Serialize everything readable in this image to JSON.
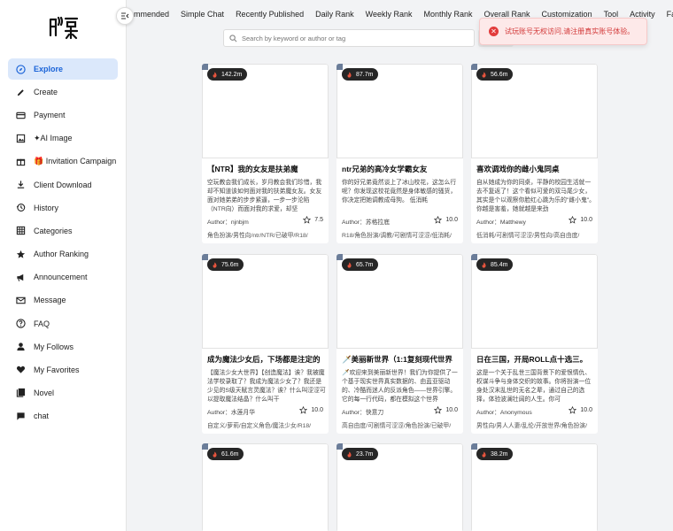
{
  "sidebar": {
    "logo_icon": "app-logo-icon",
    "items": [
      {
        "label": "Explore",
        "icon": "compass-icon",
        "active": true
      },
      {
        "label": "Create",
        "icon": "pencil-icon"
      },
      {
        "label": "Payment",
        "icon": "credit-card-icon"
      },
      {
        "label": "✦AI Image",
        "icon": "image-icon"
      },
      {
        "label": "🎁 Invitation Campaign",
        "icon": "gift-icon"
      },
      {
        "label": "Client Download",
        "icon": "download-icon"
      },
      {
        "label": "History",
        "icon": "history-icon"
      },
      {
        "label": "Categories",
        "icon": "grid-icon"
      },
      {
        "label": "Author Ranking",
        "icon": "star-icon"
      },
      {
        "label": "Announcement",
        "icon": "megaphone-icon"
      },
      {
        "label": "Message",
        "icon": "mail-icon"
      },
      {
        "label": "FAQ",
        "icon": "question-icon"
      },
      {
        "label": "My Follows",
        "icon": "user-icon"
      },
      {
        "label": "My Favorites",
        "icon": "heart-icon"
      },
      {
        "label": "Novel",
        "icon": "book-icon"
      },
      {
        "label": "chat",
        "icon": "chat-icon"
      }
    ]
  },
  "topnav": [
    "ommended",
    "Simple Chat",
    "Recently Published",
    "Daily Rank",
    "Weekly Rank",
    "Monthly Rank",
    "Overall Rank",
    "Customization",
    "Tool",
    "Activity",
    "Fav"
  ],
  "search": {
    "placeholder": "Search by keyword or author or tag"
  },
  "toast": {
    "message": "试玩账号无权访问,请注册真实账号体验。",
    "color": "#d33a3a"
  },
  "cards": [
    {
      "views": "142.2m",
      "title": "【NTR】我的女友是扶弟魔",
      "desc": "空玩教会我们成长，岁月教会我们珍惜，我却不知道该如何面对我的扶弟魔女友。女友面对她弟弟的步步紧逼，一步一步沦陷（NTR向）而面对我的求爱，却坚",
      "author": "Author：njnbjm",
      "rating": "7.5",
      "tags": "角色扮演/男性向/ntr/NTR/已破甲/R18/"
    },
    {
      "views": "87.7m",
      "title": "ntr兄弟的高冷女学霸女友",
      "desc": "你的好兄弟竟然谈上了冰山校花，这怎么行呢？你发现这校花竟然是身体敏感的骚货，你决定把她调教成母狗。 低消耗",
      "author": "Author：苏格拉底",
      "rating": "10.0",
      "tags": "R18/角色扮演/调教/可剧情可涩涩/低消耗/"
    },
    {
      "views": "56.6m",
      "title": "喜欢调戏你的雌小鬼同桌",
      "desc": "自从她成为你的同桌，平静的校园生活就一去不复返了！这个看似可爱的双马尾少女，其实是个以观察你脸红心跳为乐的\"雌小鬼\"。你越是害羞，她就越是来劲",
      "author": "Author：Matthewy",
      "rating": "10.0",
      "tags": "低消耗/可剧情可涩涩/男性向/高自由度/"
    },
    {
      "views": "75.6m",
      "title": "成为魔法少女后，下场都是注定的",
      "desc": "【魔法少女大世界】【创造魔法】诶？我被魔法学校录取了？我成为魔法少女了？我还是少见的S级天赋言灵魔法？诶？什么叫涩涩可以提取魔法结晶？什么叫干",
      "author": "Author：水莲月华",
      "rating": "10.0",
      "tags": "自定义/萝莉/自定义角色/魔法少女/R18/"
    },
    {
      "views": "65.7m",
      "title": "🗡️美丽新世界（1:1复刻现代世界",
      "desc": "🗡️欢迎来到美丽新世界！我们为你提供了一个基于现实世界真实数据的、由蓝亚驱动的、冷酷而迷人的反派角色——世界引擎。它的每一行代码，都在模拟这个世界",
      "author": "Author：快意刀",
      "rating": "10.0",
      "tags": "高自由度/可剧情可涩涩/角色扮演/已破甲/"
    },
    {
      "views": "85.4m",
      "title": "日在三国，开局ROLL点十选三。",
      "desc": "这是一个关于乱世三国背景下的爱恨情仇、权谋斗争与身体交织的故事。你将扮演一位身处汉末乱世的无名之辈，通过自己的选择，体验波澜壮阔的人生。你可",
      "author": "Author：Anonymous",
      "rating": "10.0",
      "tags": "男性向/男人人妻/乱伦/开放世界/角色扮演/"
    },
    {
      "views": "61.6m",
      "title": "",
      "desc": "",
      "author": "",
      "rating": "",
      "tags": ""
    },
    {
      "views": "23.7m",
      "title": "",
      "desc": "",
      "author": "",
      "rating": "",
      "tags": ""
    },
    {
      "views": "38.2m",
      "title": "",
      "desc": "",
      "author": "",
      "rating": "",
      "tags": ""
    }
  ]
}
